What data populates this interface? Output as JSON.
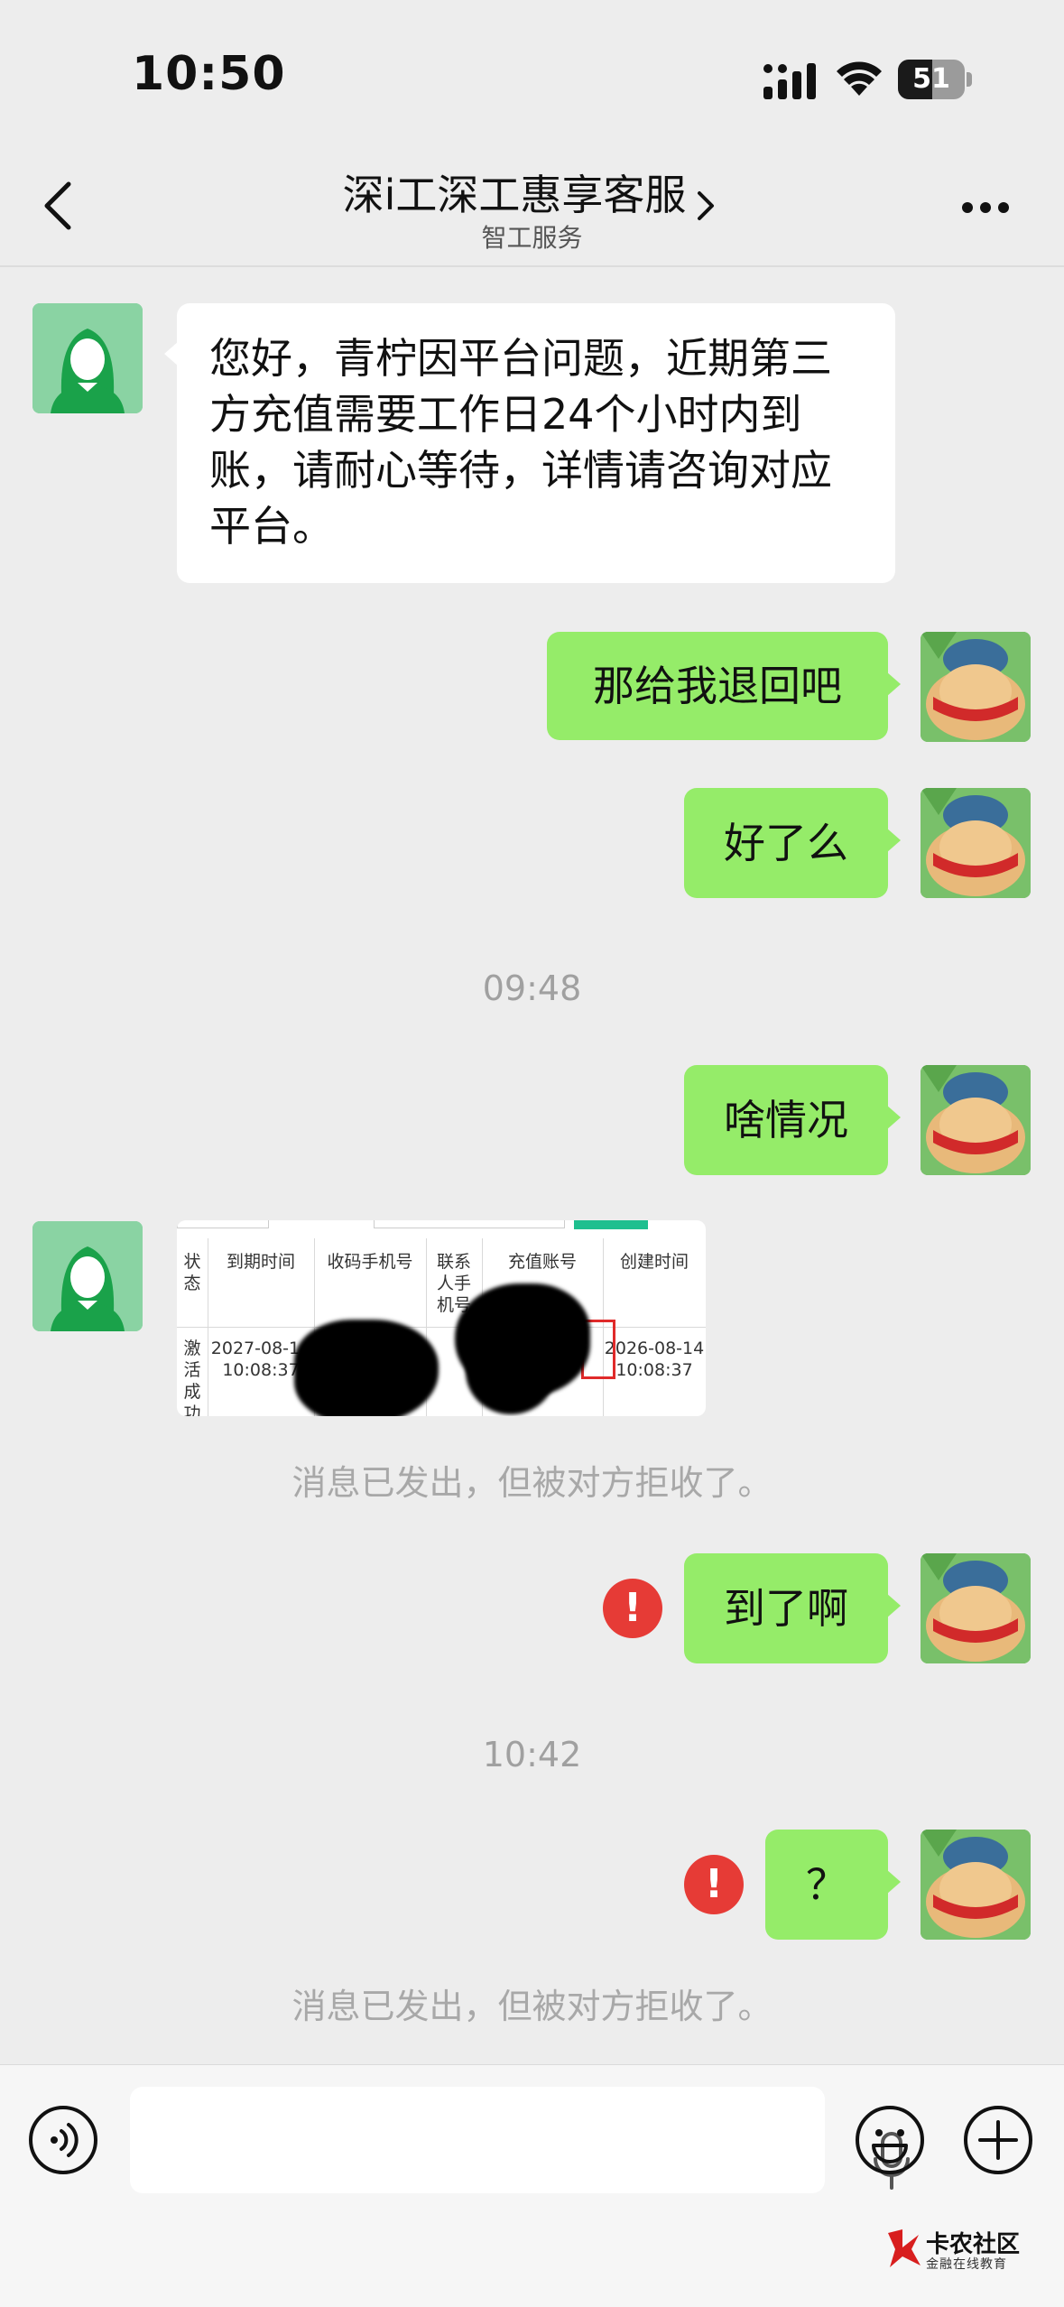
{
  "status_bar": {
    "time": "10:50",
    "battery": "51"
  },
  "nav": {
    "title": "深i工深工惠享客服",
    "subtitle": "智工服务"
  },
  "messages": {
    "agent_1": "您好，青柠因平台问题，近期第三方充值需要工作日24个小时内到账，请耐心等待，详情请咨询对应平台。",
    "user_1": "那给我退回吧",
    "user_2": "好了么",
    "time_1": "09:48",
    "user_3": "啥情况",
    "rejected_1": "消息已发出，但被对方拒收了。",
    "user_4": "到了啊",
    "time_2": "10:42",
    "user_5": "？",
    "rejected_2": "消息已发出，但被对方拒收了。",
    "error_mark": "!"
  },
  "image_message": {
    "headers": [
      "状态",
      "到期时间",
      "收码手机号",
      "联系人手机号",
      "充值账号",
      "创建时间"
    ],
    "row": [
      "激活成功",
      "2027-08-14 10:08:37",
      "",
      "",
      "",
      "2026-08-14 10:08:37"
    ],
    "header_contact": [
      "联系",
      "人手",
      "机号"
    ],
    "row_status": [
      "激活",
      "成功"
    ],
    "row_expire": [
      "2027-08-14",
      "10:08:37"
    ],
    "row_created": [
      "2026-08-14",
      "10:08:37"
    ]
  },
  "watermark": {
    "name": "卡农社区",
    "sub": "金融在线教育"
  },
  "colors": {
    "bubble_out": "#95ec69",
    "bubble_in": "#ffffff",
    "error": "#e63b36",
    "background": "#ededed"
  }
}
